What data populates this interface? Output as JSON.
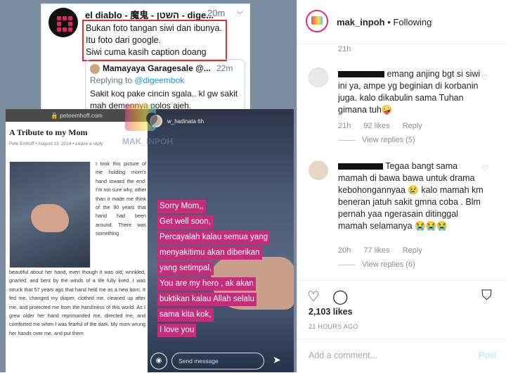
{
  "tweet": {
    "name": "el diablo - 魔鬼 - השטן - dige...",
    "time": "20m",
    "lines": [
      "Bukan foto tangan siwi dan ibunya.",
      "Itu foto dari google.",
      "Siwi cuma kasih caption doang"
    ],
    "quote": {
      "name": "Mamayaya Garagesale @...",
      "time": "22m",
      "reply_prefix": "Replying to ",
      "reply_handle": "@digeembok",
      "text": "Sakit koq pake cincin sgala.. kl gw sakit mah demennya polos ajeh."
    }
  },
  "blog": {
    "url": "peteemhoff.com",
    "title": "A Tribute to my Mom",
    "meta": "Pete Emhoff • August 13, 2014 • Leave a reply",
    "para1": "I took this picture of me holding mom's hand toward the end. I'm not sure why, other than it made me think of the 90 years that hand had been around. There was something",
    "para2": "beautiful about her hand, even though it was old, wrinkled, gnarled, and bent by the winds of a life fully lived. I was struck that 57 years ago that hand held me as a new born. It fed me, changed my diaper, clothed me, cleaned up after me, and protected me from the harshness of this world. As I grew older her hand reprimanded me, directed me, and comforted me when I was fearful of the dark. My mom wrung her hands over me, and put them"
  },
  "story": {
    "username": "w_hadinata",
    "time": "6h",
    "lines": [
      "Sorry Mom,,",
      "Get well soon,",
      "Percayalah kalau semua yang",
      "menyakitimu akan diberikan",
      "yang setimpal,",
      "You are my hero , ak akan",
      "buktikan kalau Allah selalu",
      "sama kita kok,",
      "I love you"
    ],
    "send_placeholder": "Send message"
  },
  "watermark": "MAK_INPOH",
  "instagram": {
    "username": "mak_inpoh",
    "follow_status": "• Following",
    "top_time": "21h",
    "comments": [
      {
        "text": "emang anjing bgt si siwi ini ya, ampe yg beginian di korbanin juga. kalo dikabulin sama Tuhan gimana tuh🤪",
        "time": "21h",
        "likes": "92 likes",
        "reply": "Reply",
        "view_replies": "View replies (5)"
      },
      {
        "text": "Tegaa bangt sama mamah di bawa bawa untuk drama kebohongannyaa 😢 kalo mamah km beneran jatuh sakit gmna coba . Blm pernah yaa ngerasain ditinggal mamah selamanya 😭😭😭",
        "time": "20h",
        "likes": "77 likes",
        "reply": "Reply",
        "view_replies": "View replies (6)"
      }
    ],
    "likes_total": "2,103 likes",
    "ago": "21 HOURS AGO",
    "add_comment_placeholder": "Add a comment...",
    "post_label": "Post",
    "colors": {
      "link": "#b2dffc",
      "muted": "#8e8e8e",
      "text": "#262626"
    }
  }
}
